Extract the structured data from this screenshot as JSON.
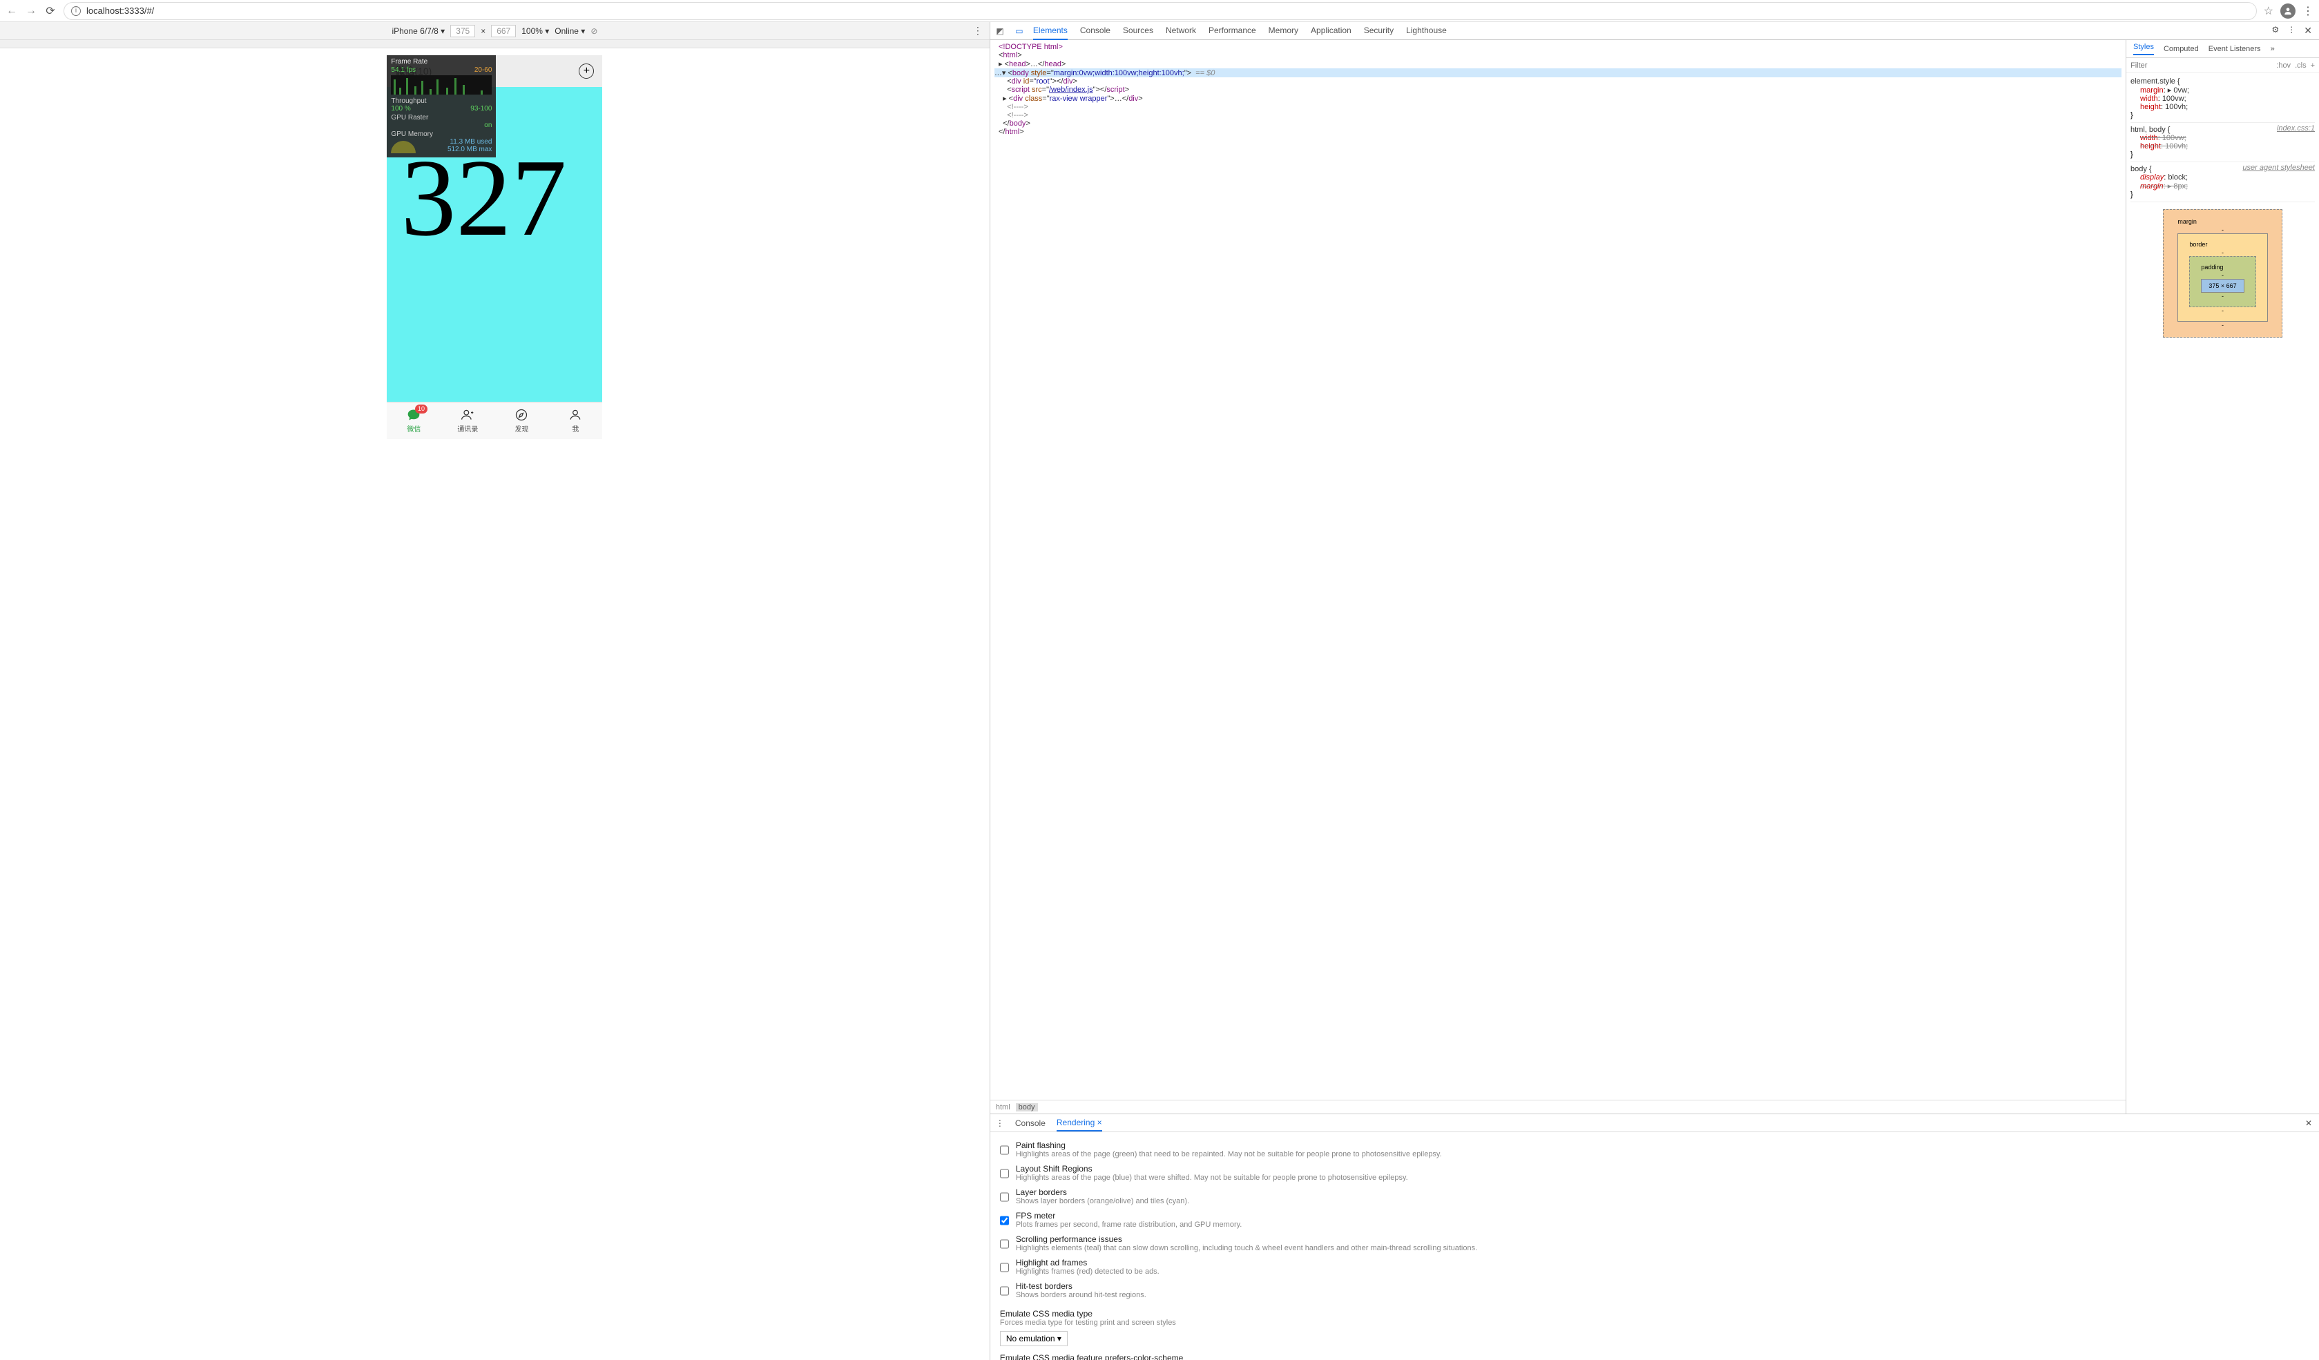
{
  "browser": {
    "url": "localhost:3333/#/"
  },
  "deviceBar": {
    "device": "iPhone 6/7/8",
    "w": "375",
    "h": "667",
    "zoom": "100%",
    "throttle": "Online"
  },
  "fps": {
    "title": "Frame Rate",
    "fps": "54.1 fps",
    "range": "20-60",
    "throughputLabel": "Throughput",
    "throughput": "100 %",
    "throughputRange": "93-100",
    "rasterLabel": "GPU Raster",
    "raster": "on",
    "memLabel": "GPU Memory",
    "memUsed": "11.3 MB used",
    "memMax": "512.0 MB max"
  },
  "app": {
    "title": "微信",
    "titleCount": "(10)",
    "bigNumber": "327",
    "badge": "10",
    "tabs": [
      "微信",
      "通讯录",
      "发现",
      "我"
    ]
  },
  "devtools": {
    "tabs": [
      "Elements",
      "Console",
      "Sources",
      "Network",
      "Performance",
      "Memory",
      "Application",
      "Security",
      "Lighthouse"
    ],
    "activeTab": "Elements",
    "dom": {
      "doctype": "<!DOCTYPE html>",
      "bodyStyle": "margin:0vw;width:100vw;height:100vh;",
      "rootId": "root",
      "scriptSrc": "/web/index.js",
      "divClass": "rax-view wrapper",
      "eq": "== $0"
    },
    "crumbs": [
      "html",
      "body"
    ],
    "stylesTabs": [
      "Styles",
      "Computed",
      "Event Listeners"
    ],
    "filterPlaceholder": "Filter",
    "hov": ":hov",
    "cls": ".cls",
    "rules": {
      "elStyle": "element.style {",
      "p1n": "margin",
      "p1v": "▸ 0vw;",
      "p2n": "width",
      "p2v": "100vw;",
      "p3n": "height",
      "p3v": "100vh;",
      "r2sel": "html, body {",
      "r2src": "index.css:1",
      "r2p1n": "width",
      "r2p1v": "100vw;",
      "r2p2n": "height",
      "r2p2v": "100vh;",
      "r3sel": "body {",
      "r3src": "user agent stylesheet",
      "r3p1n": "display",
      "r3p1v": "block;",
      "r3p2n": "margin",
      "r3p2v": "▸ 8px;"
    },
    "box": {
      "margin": "margin",
      "marginV": "-",
      "border": "border",
      "borderV": "-",
      "padding": "padding",
      "paddingV": "-",
      "content": "375 × 667"
    }
  },
  "drawer": {
    "tabs": [
      "Console",
      "Rendering"
    ],
    "active": "Rendering",
    "options": [
      {
        "t": "Paint flashing",
        "d": "Highlights areas of the page (green) that need to be repainted. May not be suitable for people prone to photosensitive epilepsy.",
        "c": false
      },
      {
        "t": "Layout Shift Regions",
        "d": "Highlights areas of the page (blue) that were shifted. May not be suitable for people prone to photosensitive epilepsy.",
        "c": false
      },
      {
        "t": "Layer borders",
        "d": "Shows layer borders (orange/olive) and tiles (cyan).",
        "c": false
      },
      {
        "t": "FPS meter",
        "d": "Plots frames per second, frame rate distribution, and GPU memory.",
        "c": true
      },
      {
        "t": "Scrolling performance issues",
        "d": "Highlights elements (teal) that can slow down scrolling, including touch & wheel event handlers and other main-thread scrolling situations.",
        "c": false
      },
      {
        "t": "Highlight ad frames",
        "d": "Highlights frames (red) detected to be ads.",
        "c": false
      },
      {
        "t": "Hit-test borders",
        "d": "Shows borders around hit-test regions.",
        "c": false
      }
    ],
    "emulate1t": "Emulate CSS media type",
    "emulate1d": "Forces media type for testing print and screen styles",
    "emulate1v": "No emulation",
    "emulate2t": "Emulate CSS media feature prefers-color-scheme"
  }
}
